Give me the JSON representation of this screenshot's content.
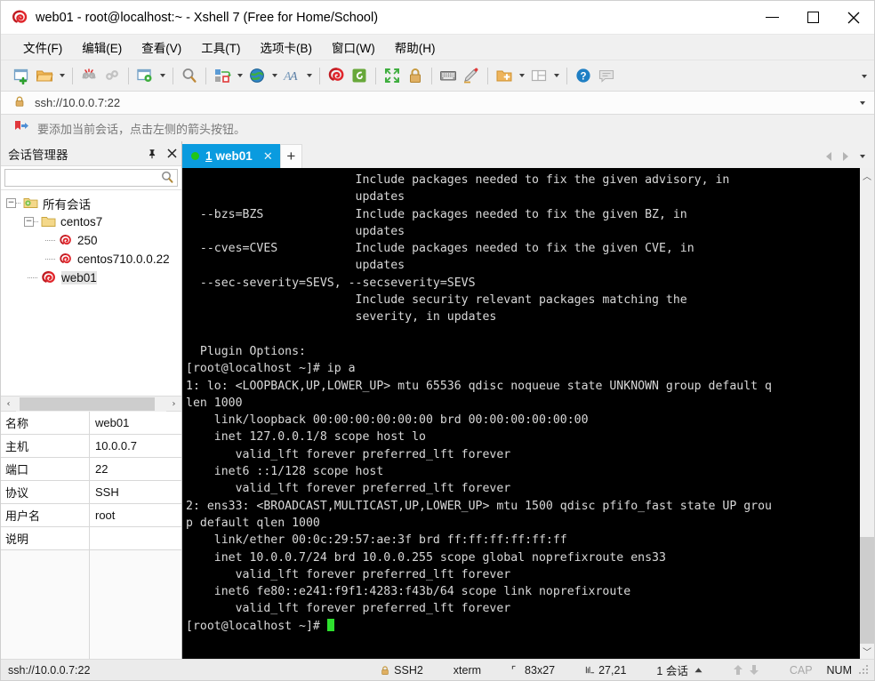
{
  "window": {
    "title": "web01 - root@localhost:~ - Xshell 7 (Free for Home/School)",
    "app_icon": "xshell-logo-icon",
    "minimize_label": "Minimize",
    "maximize_label": "Maximize",
    "close_label": "Close"
  },
  "menubar": {
    "items": [
      {
        "label": "文件(F)",
        "name": "menu-file"
      },
      {
        "label": "编辑(E)",
        "name": "menu-edit"
      },
      {
        "label": "查看(V)",
        "name": "menu-view"
      },
      {
        "label": "工具(T)",
        "name": "menu-tools"
      },
      {
        "label": "选项卡(B)",
        "name": "menu-tabs"
      },
      {
        "label": "窗口(W)",
        "name": "menu-window"
      },
      {
        "label": "帮助(H)",
        "name": "menu-help"
      }
    ]
  },
  "toolbar": {
    "icons": [
      "new-session-icon",
      "open-folder-icon",
      "disconnect-icon",
      "reconnect-icon",
      "session-properties-icon",
      "find-icon",
      "transfer-file-icon",
      "web-browser-icon",
      "font-icon",
      "xshell-icon",
      "xftp-icon",
      "fullscreen-icon",
      "lock-icon",
      "keyboard-icon",
      "highlight-icon",
      "new-folder-icon",
      "layout-icon",
      "help-icon",
      "chat-icon"
    ],
    "overflow_label": "More toolbar buttons"
  },
  "address_bar": {
    "lock_icon": "lock-icon",
    "value": "ssh://10.0.0.7:22",
    "placeholder": "ssh://10.0.0.7:22",
    "dropdown_icon": "chevron-down-icon"
  },
  "notice_bar": {
    "icon": "add-session-arrow-icon",
    "text": "要添加当前会话，点击左侧的箭头按钮。"
  },
  "sidebar": {
    "title": "会话管理器",
    "pin_icon": "pin-icon",
    "close_icon": "close-icon",
    "search": {
      "value": "",
      "placeholder": "",
      "icon": "search-icon"
    },
    "tree": [
      {
        "label": "所有会话",
        "name": "tree-node-all-sessions",
        "depth": 0,
        "expanded": true,
        "icon": "folder-gear-icon",
        "selected": false
      },
      {
        "label": "centos7",
        "name": "tree-node-centos7",
        "depth": 1,
        "expanded": true,
        "icon": "folder-icon",
        "selected": false
      },
      {
        "label": "250",
        "name": "tree-node-250",
        "depth": 2,
        "expanded": null,
        "icon": "session-icon",
        "selected": false
      },
      {
        "label": "centos710.0.0.22",
        "name": "tree-node-centos710",
        "depth": 2,
        "expanded": null,
        "icon": "session-icon",
        "selected": false
      },
      {
        "label": "web01",
        "name": "tree-node-web01",
        "depth": 1,
        "expanded": null,
        "icon": "session-icon",
        "selected": true
      }
    ],
    "hscroll": {
      "left_icon": "chevron-left-icon",
      "right_icon": "chevron-right-icon"
    },
    "properties": [
      {
        "key": "名称",
        "value": "web01"
      },
      {
        "key": "主机",
        "value": "10.0.0.7"
      },
      {
        "key": "端口",
        "value": "22"
      },
      {
        "key": "协议",
        "value": "SSH"
      },
      {
        "key": "用户名",
        "value": "root"
      },
      {
        "key": "说明",
        "value": ""
      }
    ]
  },
  "tabbar": {
    "tabs": [
      {
        "number": "1",
        "label": "web01",
        "status_dot": "connected-dot-icon",
        "close_icon": "close-icon",
        "active": true
      }
    ],
    "new_tab_label": "+",
    "prev_icon": "chevron-left-icon",
    "next_icon": "chevron-right-icon",
    "list_icon": "chevron-down-icon"
  },
  "terminal": {
    "content": "                        Include packages needed to fix the given advisory, in\n                        updates\n  --bzs=BZS             Include packages needed to fix the given BZ, in\n                        updates\n  --cves=CVES           Include packages needed to fix the given CVE, in\n                        updates\n  --sec-severity=SEVS, --secseverity=SEVS\n                        Include security relevant packages matching the\n                        severity, in updates\n\n  Plugin Options:\n[root@localhost ~]# ip a\n1: lo: <LOOPBACK,UP,LOWER_UP> mtu 65536 qdisc noqueue state UNKNOWN group default q\nlen 1000\n    link/loopback 00:00:00:00:00:00 brd 00:00:00:00:00:00\n    inet 127.0.0.1/8 scope host lo\n       valid_lft forever preferred_lft forever\n    inet6 ::1/128 scope host\n       valid_lft forever preferred_lft forever\n2: ens33: <BROADCAST,MULTICAST,UP,LOWER_UP> mtu 1500 qdisc pfifo_fast state UP grou\np default qlen 1000\n    link/ether 00:0c:29:57:ae:3f brd ff:ff:ff:ff:ff:ff\n    inet 10.0.0.7/24 brd 10.0.0.255 scope global noprefixroute ens33\n       valid_lft forever preferred_lft forever\n    inet6 fe80::e241:f9f1:4283:f43b/64 scope link noprefixroute\n       valid_lft forever preferred_lft forever\n",
    "prompt": "[root@localhost ~]# ",
    "scroll_up_icon": "chevron-up-icon",
    "scroll_down_icon": "chevron-down-icon"
  },
  "statusbar": {
    "connection": "ssh://10.0.0.7:22",
    "security_icon": "lock-icon",
    "protocol": "SSH2",
    "terminal_type": "xterm",
    "size_icon": "screen-size-icon",
    "size": "83x27",
    "cursor_icon": "cursor-position-icon",
    "cursor": "27,21",
    "sessions": "1 会话",
    "sessions_caret": "caret-up-icon",
    "upload_icon": "arrow-up-icon",
    "download_icon": "arrow-down-icon",
    "caps": "CAP",
    "num": "NUM"
  },
  "colors": {
    "accent": "#0a9bdf",
    "terminal_bg": "#000000",
    "terminal_fg": "#d8d8d8",
    "cursor": "#2ee02e",
    "connected": "#22c517"
  }
}
